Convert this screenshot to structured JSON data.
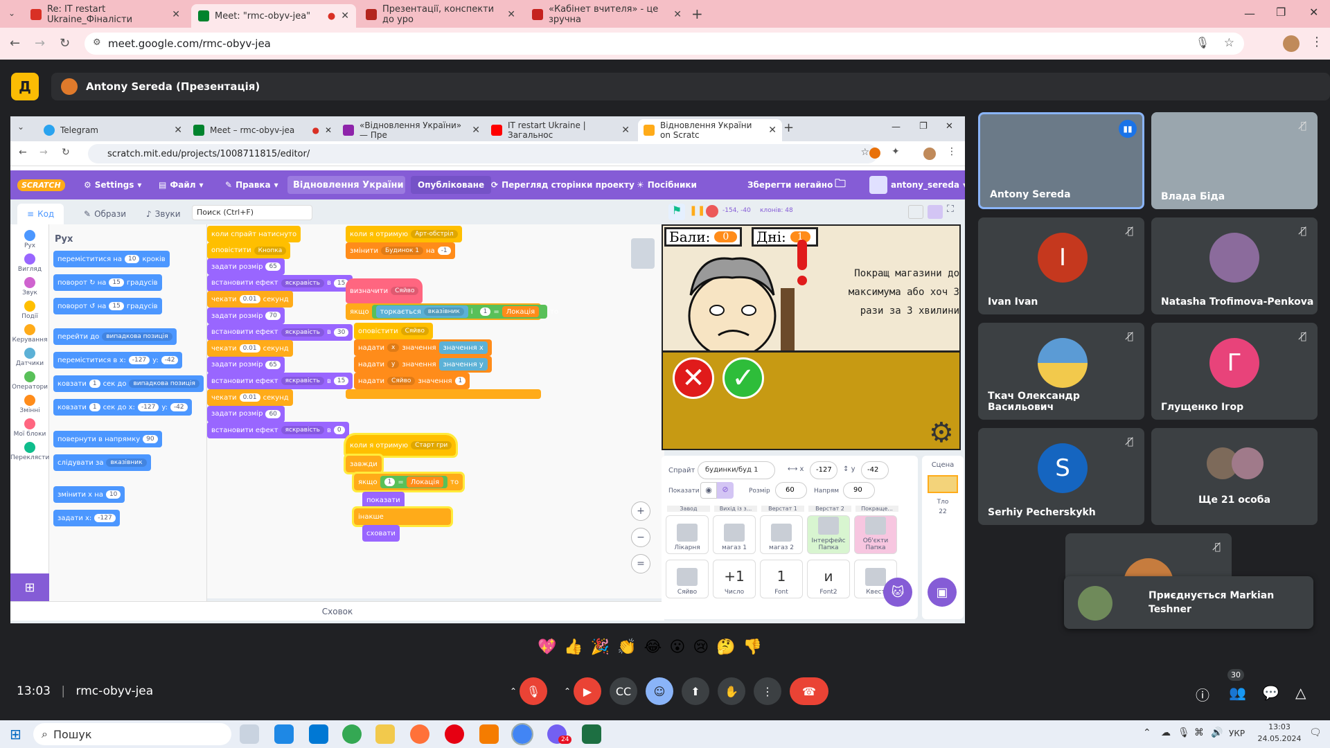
{
  "browser_tabs": [
    {
      "title": "Re: IT restart Ukraine_Фіналісти",
      "color": "#d93025"
    },
    {
      "title": "Meet: \"rmc-obyv-jea\"",
      "color": "#00832d",
      "recording": "●"
    },
    {
      "title": "Презентації, конспекти до уро",
      "color": "#b3261e"
    },
    {
      "title": "«Кабінет вчителя» - це зручна",
      "color": "#c5221f"
    }
  ],
  "browser_url": "meet.google.com/rmc-obyv-jea",
  "presenter": {
    "name": "Antony Sereda (Презентація)"
  },
  "shared": {
    "tabs": [
      {
        "title": "Telegram"
      },
      {
        "title": "Meet – rmc-obyv-jea"
      },
      {
        "title": "«Відновлення України» — Пре"
      },
      {
        "title": "IT restart Ukraine | Загальнос"
      },
      {
        "title": "Відновлення України on Scratc"
      }
    ],
    "url": "scratch.mit.edu/projects/1008711815/editor/",
    "menu": {
      "logo": "SCRATCH",
      "settings": "Settings",
      "file": "Файл",
      "edit": "Правка",
      "project_title": "Відновлення України",
      "publish": "Опубліковане",
      "see_page": "Перегляд сторінки проекту",
      "tutorials": "Посібники",
      "save": "Зберегти негайно",
      "user": "antony_sereda"
    },
    "editor_tabs": {
      "code": "Код",
      "costumes": "Образи",
      "sounds": "Звуки"
    },
    "search_placeholder": "Поиск (Ctrl+F)",
    "categories": [
      "Рух",
      "Вигляд",
      "Звук",
      "Події",
      "Керування",
      "Датчики",
      "Оператори",
      "Змінні",
      "Мої блоки",
      "Переклясти"
    ],
    "palette_title": "Рух",
    "palette": [
      {
        "pre": "переміститися на",
        "val": "10",
        "post": "кроків"
      },
      {
        "pre": "поворот ↻ на",
        "val": "15",
        "post": "градусів"
      },
      {
        "pre": "поворот ↺ на",
        "val": "15",
        "post": "градусів"
      },
      {
        "pre": "перейти до",
        "dd": "випадкова позиція"
      },
      {
        "pre": "переміститися в x:",
        "val": "-127",
        "post": "y:",
        "val2": "-42"
      },
      {
        "pre": "ковзати",
        "val": "1",
        "post": "сек до",
        "dd": "випадкова позиція"
      },
      {
        "pre": "ковзати",
        "val": "1",
        "post": "сек до x:",
        "val2": "-127",
        "post2": "y:",
        "val3": "-42"
      },
      {
        "pre": "повернути в напрямку",
        "val": "90"
      },
      {
        "pre": "слідувати за",
        "dd": "вказівник"
      },
      {
        "pre": "змінити x на",
        "val": "10"
      },
      {
        "pre": "задати x:",
        "val": "-127"
      }
    ],
    "script1": [
      {
        "t": "коли спрайт натиснуто",
        "c": "ev"
      },
      {
        "t": "оповістити",
        "dd": "Кнопка",
        "c": "ev"
      },
      {
        "t": "задати розмір",
        "v": "65",
        "c": "looks"
      },
      {
        "t": "встановити ефект",
        "dd": "яскравість",
        "p": "в",
        "v": "15",
        "c": "looks"
      },
      {
        "t": "чекати",
        "v": "0.01",
        "p": "секунд",
        "c": "ctrl"
      },
      {
        "t": "задати розмір",
        "v": "70",
        "c": "looks"
      },
      {
        "t": "встановити ефект",
        "dd": "яскравість",
        "p": "в",
        "v": "30",
        "c": "looks"
      },
      {
        "t": "чекати",
        "v": "0.01",
        "p": "секунд",
        "c": "ctrl"
      },
      {
        "t": "задати розмір",
        "v": "65",
        "c": "looks"
      },
      {
        "t": "встановити ефект",
        "dd": "яскравість",
        "p": "в",
        "v": "15",
        "c": "looks"
      },
      {
        "t": "чекати",
        "v": "0.01",
        "p": "секунд",
        "c": "ctrl"
      },
      {
        "t": "задати розмір",
        "v": "60",
        "c": "looks"
      },
      {
        "t": "встановити ефект",
        "dd": "яскравість",
        "p": "в",
        "v": "0",
        "c": "looks"
      }
    ],
    "script2": [
      {
        "t": "коли я отримую",
        "dd": "Арт-обстріл",
        "c": "ev"
      },
      {
        "t": "змінити",
        "dd": "Будинок 1",
        "p": "на",
        "v": "-1",
        "c": "var"
      }
    ],
    "script3": {
      "define": "визначити",
      "name": "Сяйво",
      "if": "якщо",
      "touching": "торкається",
      "pointer": "вказівник",
      "and": "і",
      "one": "1",
      "eq": "=",
      "loc": "Локація",
      "then": "то",
      "broadcast": "оповістити",
      "b_dd": "Сяйво",
      "set_x": "надати",
      "x_dd": "х",
      "to": "значення",
      "x_val": "значення х",
      "y_dd": "у",
      "y_val": "значення у",
      "s_dd": "Сяйво",
      "s_v": "1"
    },
    "script4": {
      "hat": "коли я отримую",
      "dd": "Старт гри",
      "forever": "завжди",
      "if": "якщо",
      "one": "1",
      "eq": "=",
      "loc": "Локація",
      "then": "то",
      "show": "показати",
      "else": "інакше",
      "hide": "сховати"
    },
    "backpack": "Схoвок",
    "stage": {
      "coords": "-154, -40",
      "clones": "клонів: 48",
      "score_label": "Бали:",
      "score": "0",
      "days_label": "Дні:",
      "days": "1",
      "message": "Покращ магазини до максимума або хоч 3 рази за 3 хвилини"
    },
    "sprite_info": {
      "label": "Спрайт",
      "name": "будинки/буд 1",
      "x_label": "x",
      "x": "-127",
      "y_label": "y",
      "y": "-42",
      "show": "Показати",
      "size_label": "Розмір",
      "size": "60",
      "dir_label": "Напрям",
      "dir": "90"
    },
    "sprite_row_labels": [
      "Завод",
      "Вихід із з...",
      "Верстат 1",
      "Верстат 2",
      "Покраще..."
    ],
    "sprites": [
      {
        "name": "Лікарня"
      },
      {
        "name": "магаз 1"
      },
      {
        "name": "магаз 2"
      },
      {
        "name": "Інтерфейс",
        "sub": "Папка"
      },
      {
        "name": "Об'єкти",
        "sub": "Папка"
      },
      {
        "name": "Сяйво"
      },
      {
        "name": "Число",
        "glyph": "+1"
      },
      {
        "name": "Font",
        "glyph": "1"
      },
      {
        "name": "Font2",
        "glyph": "и"
      },
      {
        "name": "Квест"
      }
    ],
    "backdrop": {
      "title": "Сцена",
      "label": "Тло",
      "count": "22"
    }
  },
  "participants": [
    {
      "name": "Antony Sereda",
      "active": true
    },
    {
      "name": "Влада Біда"
    },
    {
      "name": "Ivan Ivan",
      "initial": "I",
      "color": "#c5381e"
    },
    {
      "name": "Natasha Trofimova-Penkova"
    },
    {
      "name": "Ткач Олександр Васильович"
    },
    {
      "name": "Глущенко Ігор",
      "initial": "Г",
      "color": "#e8437a"
    },
    {
      "name": "Serhiy Pecherskykh",
      "initial": "S",
      "color": "#1565c0"
    },
    {
      "name": "Ще 21 особа"
    }
  ],
  "join_toast": "Приєднується Markian Teshner",
  "reactions": [
    "💖",
    "👍",
    "🎉",
    "👏",
    "😂",
    "😮",
    "😢",
    "🤔",
    "👎"
  ],
  "meeting": {
    "time": "13:03",
    "code": "rmc-obyv-jea",
    "people_count": "30"
  },
  "taskbar": {
    "search": "Пошук",
    "lang": "УКР",
    "time": "13:03",
    "date": "24.05.2024",
    "opera_badge": "24"
  }
}
